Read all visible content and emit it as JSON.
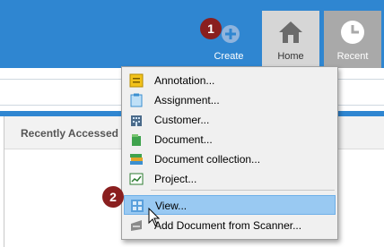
{
  "toolbar": {
    "create_label": "Create",
    "home_label": "Home",
    "recent_label": "Recent"
  },
  "badges": {
    "first": "1",
    "second": "2"
  },
  "panel": {
    "title": "Recently Accessed b"
  },
  "menu": {
    "items": [
      {
        "label": "Annotation...",
        "icon": "annotation-icon"
      },
      {
        "label": "Assignment...",
        "icon": "assignment-icon"
      },
      {
        "label": "Customer...",
        "icon": "customer-icon"
      },
      {
        "label": "Document...",
        "icon": "document-icon"
      },
      {
        "label": "Document collection...",
        "icon": "document-collection-icon"
      },
      {
        "label": "Project...",
        "icon": "project-icon"
      },
      {
        "label": "View...",
        "icon": "view-icon"
      },
      {
        "label": "Add Document from Scanner...",
        "icon": "scanner-icon"
      }
    ],
    "highlighted": "View..."
  },
  "colors": {
    "toolbar_blue": "#2f86d1",
    "highlight": "#99c9f2",
    "badge": "#8a1f1f"
  }
}
